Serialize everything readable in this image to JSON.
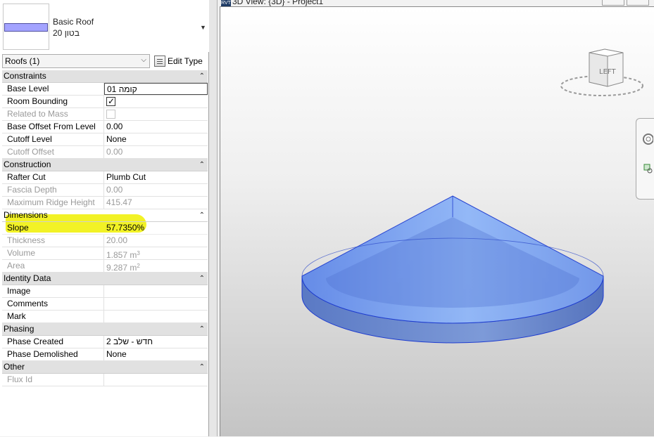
{
  "type_selector": {
    "family": "Basic Roof",
    "type": "בטון 20"
  },
  "instance": {
    "selector": "Roofs (1)",
    "edit_type": "Edit Type"
  },
  "categories": {
    "constraints": "Constraints",
    "construction": "Construction",
    "dimensions": "Dimensions",
    "identity": "Identity Data",
    "phasing": "Phasing",
    "other": "Other"
  },
  "props": {
    "base_level": {
      "name": "Base Level",
      "value": "קומה 01"
    },
    "room_bounding": {
      "name": "Room Bounding",
      "checked": true
    },
    "related_to_mass": {
      "name": "Related to Mass",
      "checked": false
    },
    "base_offset": {
      "name": "Base Offset From Level",
      "value": "0.00"
    },
    "cutoff_level": {
      "name": "Cutoff Level",
      "value": "None"
    },
    "cutoff_offset": {
      "name": "Cutoff Offset",
      "value": "0.00"
    },
    "rafter_cut": {
      "name": "Rafter Cut",
      "value": "Plumb Cut"
    },
    "fascia_depth": {
      "name": "Fascia Depth",
      "value": "0.00"
    },
    "max_ridge": {
      "name": "Maximum Ridge Height",
      "value": "415.47"
    },
    "slope": {
      "name": "Slope",
      "value": "57.7350%"
    },
    "thickness": {
      "name": "Thickness",
      "value": "20.00"
    },
    "volume": {
      "name": "Volume",
      "value": "1.857 m",
      "unit_exp": "3"
    },
    "area": {
      "name": "Area",
      "value": "9.287 m",
      "unit_exp": "2"
    },
    "image": {
      "name": "Image",
      "value": ""
    },
    "comments": {
      "name": "Comments",
      "value": ""
    },
    "mark": {
      "name": "Mark",
      "value": ""
    },
    "phase_created": {
      "name": "Phase Created",
      "value": "חדש - שלב 2"
    },
    "phase_demolished": {
      "name": "Phase Demolished",
      "value": "None"
    },
    "flux_id": {
      "name": "Flux Id",
      "value": ""
    }
  },
  "view": {
    "title": "3D View: {3D} - Project1",
    "app_icon": "RVT",
    "viewcube_face": "LEFT"
  },
  "colors": {
    "roof_fill": "#7aa6f5",
    "roof_edge": "#1e3ccf",
    "highlight": "#f0f000"
  },
  "icons": [
    "edit-type-icon",
    "collapse-icon",
    "dropdown-icon",
    "steering-wheel-icon",
    "zoom-icon",
    "viewcube-icon"
  ]
}
